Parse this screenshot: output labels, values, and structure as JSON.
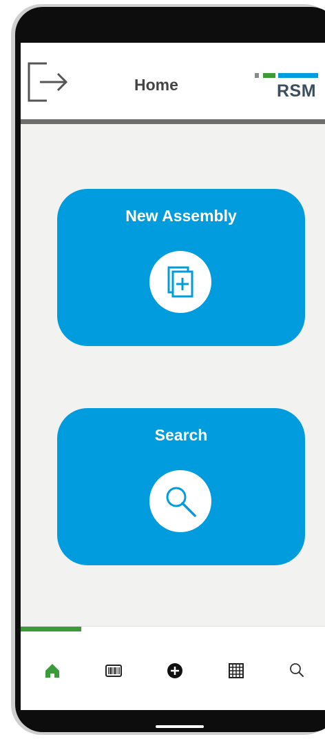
{
  "header": {
    "title": "Home",
    "exit_icon": "exit-icon",
    "logo": {
      "text": "RSM",
      "colors": [
        "#888b8d",
        "#3f9c35",
        "#009cde"
      ]
    }
  },
  "cards": [
    {
      "title": "New Assembly",
      "icon": "new-document-icon"
    },
    {
      "title": "Search",
      "icon": "search-icon"
    }
  ],
  "bottom_nav": {
    "active_color": "#3b9b3b",
    "items": [
      {
        "id": "home",
        "icon": "home-icon",
        "active": true
      },
      {
        "id": "scan",
        "icon": "barcode-icon",
        "active": false
      },
      {
        "id": "add",
        "icon": "add-icon",
        "active": false
      },
      {
        "id": "grid",
        "icon": "grid-icon",
        "active": false
      },
      {
        "id": "search",
        "icon": "search-icon",
        "active": false
      }
    ]
  },
  "colors": {
    "accent": "#009cde",
    "background": "#f2f2f0",
    "header_border": "#6e6e6e"
  }
}
